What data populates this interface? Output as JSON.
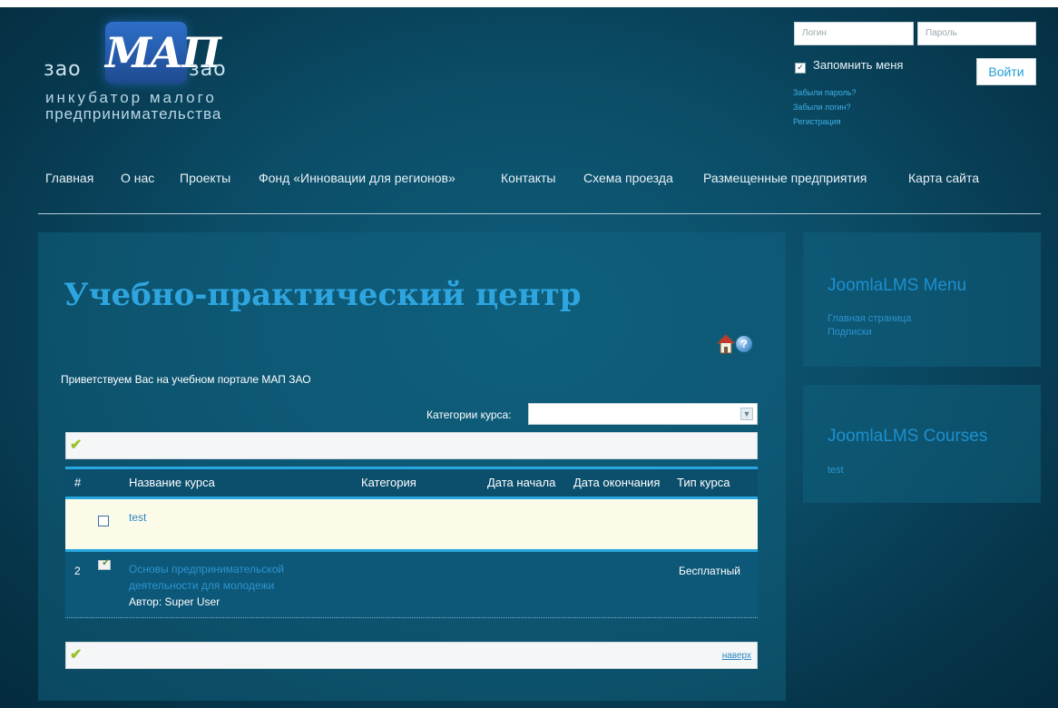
{
  "logo": {
    "left_word": "зао",
    "mark": "МАП",
    "right_word": "зао",
    "subtitle_line1": "инкубатор малого",
    "subtitle_line2": "предпринимательства"
  },
  "login": {
    "username_placeholder": "Логин",
    "password_placeholder": "Пароль",
    "remember_label": "Запомнить меня",
    "remember_checked": true,
    "submit_label": "Войти",
    "forgot_password": "Забыли пароль?",
    "forgot_login": "Забыли логин?",
    "register": "Регистрация"
  },
  "nav": [
    "Главная",
    "О нас",
    "Проекты",
    "Фонд «Инновации для регионов»",
    "Контакты",
    "Схема проезда",
    "Размещенные предприятия",
    "Карта сайта"
  ],
  "main": {
    "title": "Учебно-практический центр",
    "welcome": "Приветствуем Вас на учебном портале МАП ЗАО",
    "category_label": "Категории курса:",
    "category_value": "",
    "back_to_top": "наверх",
    "table": {
      "headers": [
        "#",
        "Название курса",
        "Категория",
        "Дата начала",
        "Дата окончания",
        "Тип курса"
      ],
      "rows": [
        {
          "num": "",
          "title": "test",
          "author": "",
          "type": ""
        },
        {
          "num": "2",
          "title": "Основы предпринимательской деятельности для молодежи",
          "author": "Автор: Super User",
          "type": "Бесплатный"
        }
      ]
    }
  },
  "sidebar": {
    "menu_title": "JoomlaLMS Menu",
    "menu_items": [
      "Главная страница",
      "Подписки"
    ],
    "courses_title": "JoomlaLMS Courses",
    "courses": [
      "test"
    ]
  }
}
